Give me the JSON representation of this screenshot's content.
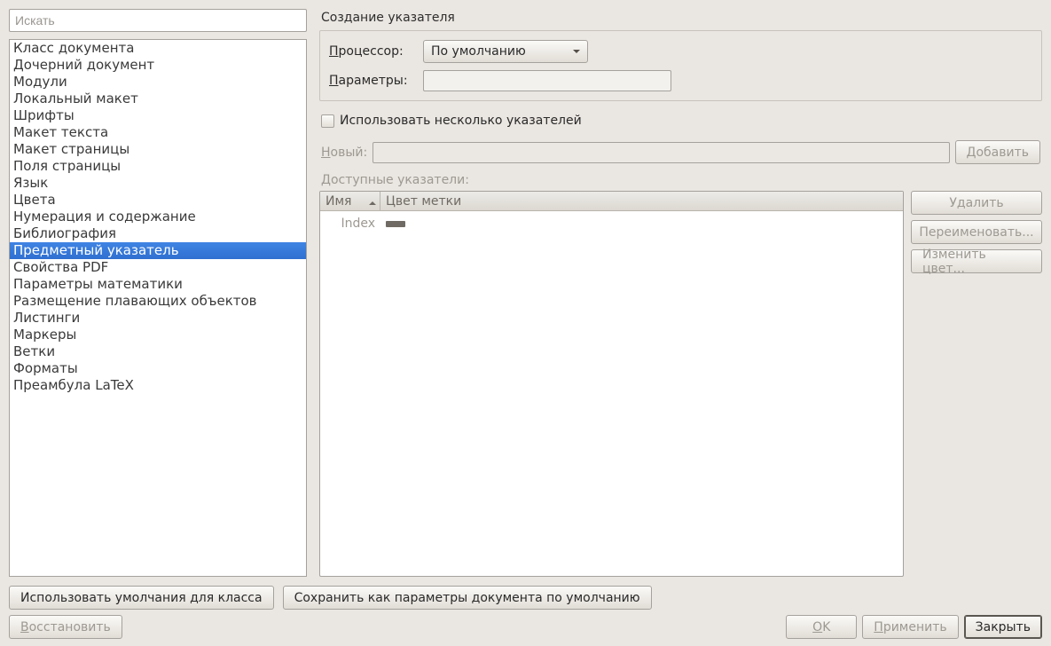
{
  "search": {
    "placeholder": "Искать"
  },
  "categories": {
    "items": [
      {
        "label": "Класс документа"
      },
      {
        "label": "Дочерний документ"
      },
      {
        "label": "Модули"
      },
      {
        "label": "Локальный макет"
      },
      {
        "label": "Шрифты"
      },
      {
        "label": "Макет текста"
      },
      {
        "label": "Макет страницы"
      },
      {
        "label": "Поля страницы"
      },
      {
        "label": "Язык"
      },
      {
        "label": "Цвета"
      },
      {
        "label": "Нумерация и содержание"
      },
      {
        "label": "Библиография"
      },
      {
        "label": "Предметный указатель"
      },
      {
        "label": "Свойства PDF"
      },
      {
        "label": "Параметры математики"
      },
      {
        "label": "Размещение плавающих объектов"
      },
      {
        "label": "Листинги"
      },
      {
        "label": "Маркеры"
      },
      {
        "label": "Ветки"
      },
      {
        "label": "Форматы"
      },
      {
        "label": "Преамбула LaTeX"
      }
    ],
    "selectedIndex": 12
  },
  "main": {
    "title": "Создание указателя",
    "processor_label_pre": "П",
    "processor_label_post": "роцессор:",
    "processor_value": "По умолчанию",
    "params_label_pre": "П",
    "params_label_post": "араметры:",
    "params_value": "",
    "multipleIndexes_label": "Использовать несколько указателей",
    "new_label_pre": "Н",
    "new_label_post": "овый:",
    "add_button_pre": "Д",
    "add_button_post": "обавить",
    "available_label": "Доступные указатели:",
    "grid": {
      "col_name": "Имя",
      "col_color": "Цвет метки",
      "rows": [
        {
          "name": "Index",
          "color": "#6f6a63"
        }
      ]
    },
    "delete_button": "Удалить",
    "rename_button": "Переименовать...",
    "recolor_button": "Изменить цвет..."
  },
  "footer": {
    "useClassDefaults": "Использовать умолчания для класса",
    "saveAsDefaults": "Сохранить как параметры документа по умолчанию",
    "restore_pre": "В",
    "restore_post": "осстановить",
    "ok_pre": "O",
    "ok_post": "K",
    "apply_pre": "П",
    "apply_post": "рименить",
    "close": "Закрыть"
  }
}
